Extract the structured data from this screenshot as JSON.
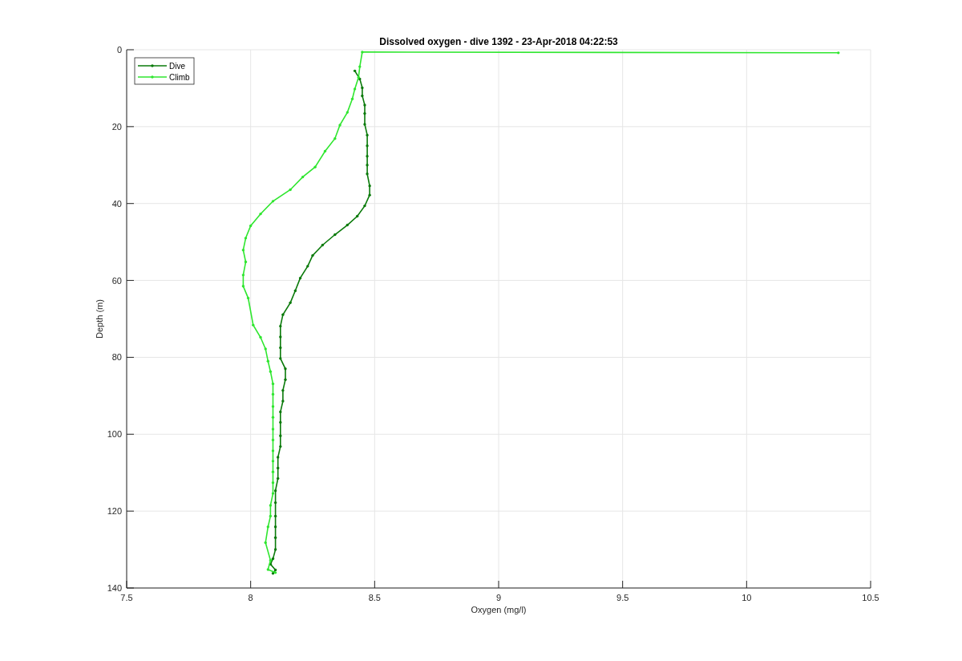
{
  "figure": {
    "chart_data": {
      "type": "line",
      "title": "Dissolved oxygen - dive 1392 - 23-Apr-2018 04:22:53",
      "grid": true,
      "legend": true,
      "xlabel": "Oxygen (mg/l)",
      "ylabel": "Depth (m)",
      "xlim": [
        7.5,
        10.5
      ],
      "ylim": [
        140,
        0
      ],
      "xticks": [
        {
          "value": 7.5,
          "label": "7.5"
        },
        {
          "value": 8,
          "label": "8"
        },
        {
          "value": 8.5,
          "label": "8.5"
        },
        {
          "value": 9,
          "label": "9"
        },
        {
          "value": 9.5,
          "label": "9.5"
        },
        {
          "value": 10,
          "label": "10"
        },
        {
          "value": 10.5,
          "label": "10.5"
        }
      ],
      "yticks": [
        {
          "value": 0,
          "label": "0"
        },
        {
          "value": 20,
          "label": "20"
        },
        {
          "value": 40,
          "label": "40"
        },
        {
          "value": 60,
          "label": "60"
        },
        {
          "value": 80,
          "label": "80"
        },
        {
          "value": 100,
          "label": "100"
        },
        {
          "value": 120,
          "label": "120"
        },
        {
          "value": 140,
          "label": "140"
        }
      ],
      "series": [
        {
          "name": "Dive",
          "color": "#0a7a0a",
          "x": [
            8.42,
            8.44,
            8.45,
            8.45,
            8.46,
            8.46,
            8.46,
            8.47,
            8.47,
            8.47,
            8.47,
            8.47,
            8.48,
            8.48,
            8.46,
            8.43,
            8.39,
            8.34,
            8.29,
            8.25,
            8.23,
            8.2,
            8.18,
            8.16,
            8.13,
            8.12,
            8.12,
            8.12,
            8.12,
            8.14,
            8.14,
            8.13,
            8.13,
            8.12,
            8.12,
            8.12,
            8.12,
            8.11,
            8.11,
            8.11,
            8.1,
            8.1,
            8.1,
            8.1,
            8.1,
            8.1,
            8.09,
            8.08,
            8.1,
            8.09
          ],
          "values": [
            5.5,
            7.6,
            9.9,
            12.0,
            14.4,
            16.6,
            19.4,
            22.2,
            25.0,
            27.7,
            30.0,
            32.3,
            35.4,
            37.8,
            40.6,
            43.3,
            45.6,
            48.1,
            50.8,
            53.5,
            56.3,
            59.4,
            62.7,
            65.8,
            68.9,
            71.9,
            74.7,
            77.5,
            80.3,
            83.0,
            85.8,
            88.6,
            91.4,
            94.2,
            96.9,
            100.4,
            103.2,
            106.0,
            108.8,
            111.5,
            114.7,
            117.8,
            121.3,
            124.1,
            126.9,
            130.0,
            132.4,
            133.8,
            135.3,
            136.2
          ]
        },
        {
          "name": "Climb",
          "color": "#2fe62f",
          "x": [
            8.1,
            8.07,
            8.08,
            8.06,
            8.07,
            8.08,
            8.08,
            8.09,
            8.09,
            8.09,
            8.09,
            8.09,
            8.09,
            8.09,
            8.09,
            8.09,
            8.09,
            8.09,
            8.08,
            8.07,
            8.06,
            8.04,
            8.01,
            7.99,
            7.97,
            7.97,
            7.98,
            7.97,
            7.98,
            8.0,
            8.04,
            8.09,
            8.16,
            8.21,
            8.26,
            8.3,
            8.34,
            8.36,
            8.39,
            8.41,
            8.42,
            8.435,
            8.44,
            8.45,
            10.37
          ],
          "values": [
            136.0,
            135.2,
            132.8,
            128.2,
            124.1,
            121.3,
            118.5,
            115.4,
            112.6,
            109.8,
            107.0,
            104.3,
            101.5,
            98.7,
            95.6,
            92.8,
            89.6,
            86.9,
            83.7,
            81.0,
            77.8,
            74.8,
            71.6,
            64.6,
            61.5,
            58.6,
            55.2,
            52.1,
            49.0,
            45.8,
            42.7,
            39.4,
            36.4,
            33.1,
            30.5,
            26.4,
            23.1,
            19.6,
            16.3,
            12.8,
            10.2,
            7.2,
            4.4,
            0.6,
            0.8
          ]
        }
      ]
    }
  }
}
